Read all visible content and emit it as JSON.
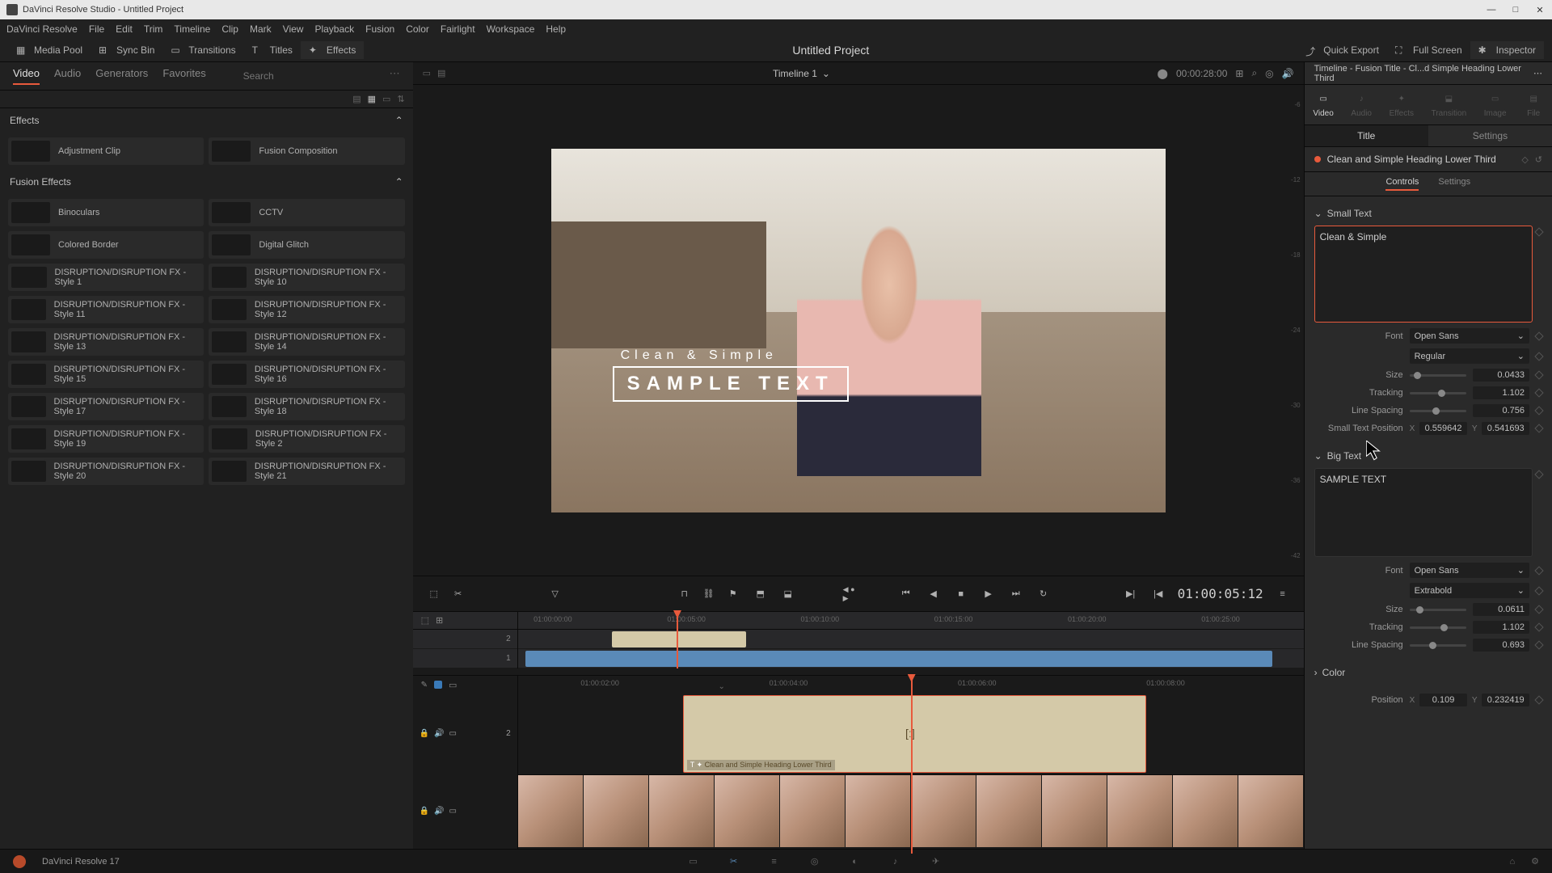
{
  "window": {
    "title": "DaVinci Resolve Studio - Untitled Project",
    "app_name": "DaVinci Resolve 17"
  },
  "menubar": [
    "DaVinci Resolve",
    "File",
    "Edit",
    "Trim",
    "Timeline",
    "Clip",
    "Mark",
    "View",
    "Playback",
    "Fusion",
    "Color",
    "Fairlight",
    "Workspace",
    "Help"
  ],
  "toolbar": {
    "media_pool": "Media Pool",
    "sync_bin": "Sync Bin",
    "transitions": "Transitions",
    "titles": "Titles",
    "effects": "Effects",
    "quick_export": "Quick Export",
    "full_screen": "Full Screen",
    "inspector": "Inspector"
  },
  "project_title": "Untitled Project",
  "left_panel": {
    "tabs": [
      "Video",
      "Audio",
      "Generators",
      "Favorites"
    ],
    "active_tab": 0,
    "search_placeholder": "Search",
    "sections": {
      "effects": "Effects",
      "fusion_effects": "Fusion Effects"
    },
    "effects_items": [
      "Adjustment Clip",
      "Fusion Composition"
    ],
    "fusion_items_col1": [
      "Binoculars",
      "Colored Border",
      "DISRUPTION/DISRUPTION FX - Style 1",
      "DISRUPTION/DISRUPTION FX - Style 11",
      "DISRUPTION/DISRUPTION FX - Style 13",
      "DISRUPTION/DISRUPTION FX - Style 15",
      "DISRUPTION/DISRUPTION FX - Style 17",
      "DISRUPTION/DISRUPTION FX - Style 19",
      "DISRUPTION/DISRUPTION FX - Style 20"
    ],
    "fusion_items_col2": [
      "CCTV",
      "Digital Glitch",
      "DISRUPTION/DISRUPTION FX - Style 10",
      "DISRUPTION/DISRUPTION FX - Style 12",
      "DISRUPTION/DISRUPTION FX - Style 14",
      "DISRUPTION/DISRUPTION FX - Style 16",
      "DISRUPTION/DISRUPTION FX - Style 18",
      "DISRUPTION/DISRUPTION FX - Style 2",
      "DISRUPTION/DISRUPTION FX - Style 21"
    ]
  },
  "viewer": {
    "timeline_name": "Timeline 1",
    "duration": "00:00:28:00",
    "timecode": "01:00:05:12",
    "title_small": "Clean & Simple",
    "title_big": "SAMPLE TEXT",
    "scale_marks": [
      "-6",
      "-12",
      "-18",
      "-24",
      "-30",
      "-36",
      "-42"
    ]
  },
  "timeline": {
    "ruler_marks": [
      "01:00:00:00",
      "01:00:05:00",
      "01:00:10:00",
      "01:00:15:00",
      "01:00:20:00",
      "01:00:25:00"
    ],
    "track_labels": [
      "2",
      "1"
    ],
    "detail_ruler": [
      "01:00:02:00",
      "01:00:04:00",
      "01:00:06:00",
      "01:00:08:00"
    ],
    "detail_track_label": "2",
    "clip_label": "Clean and Simple Heading Lower Third"
  },
  "inspector": {
    "header": "Timeline - Fusion Title - Cl...d Simple Heading Lower Third",
    "tabs": [
      "Video",
      "Audio",
      "Effects",
      "Transition",
      "Image",
      "File"
    ],
    "active_tab": 0,
    "subtabs": [
      "Title",
      "Settings"
    ],
    "clip_name": "Clean and Simple Heading Lower Third",
    "controls_tabs": [
      "Controls",
      "Settings"
    ],
    "small_text": {
      "header": "Small Text",
      "value": "Clean & Simple",
      "font_label": "Font",
      "font": "Open Sans",
      "weight": "Regular",
      "size_label": "Size",
      "size": "0.0433",
      "tracking_label": "Tracking",
      "tracking": "1.102",
      "line_spacing_label": "Line Spacing",
      "line_spacing": "0.756",
      "position_label": "Small Text Position",
      "pos_x": "0.559642",
      "pos_y": "0.541693"
    },
    "big_text": {
      "header": "Big Text",
      "value": "SAMPLE TEXT",
      "font_label": "Font",
      "font": "Open Sans",
      "weight": "Extrabold",
      "size_label": "Size",
      "size": "0.0611",
      "tracking_label": "Tracking",
      "tracking": "1.102",
      "line_spacing_label": "Line Spacing",
      "line_spacing": "0.693"
    },
    "color_section": "Color",
    "position": {
      "label": "Position",
      "x": "0.109",
      "y": "0.232419"
    }
  }
}
